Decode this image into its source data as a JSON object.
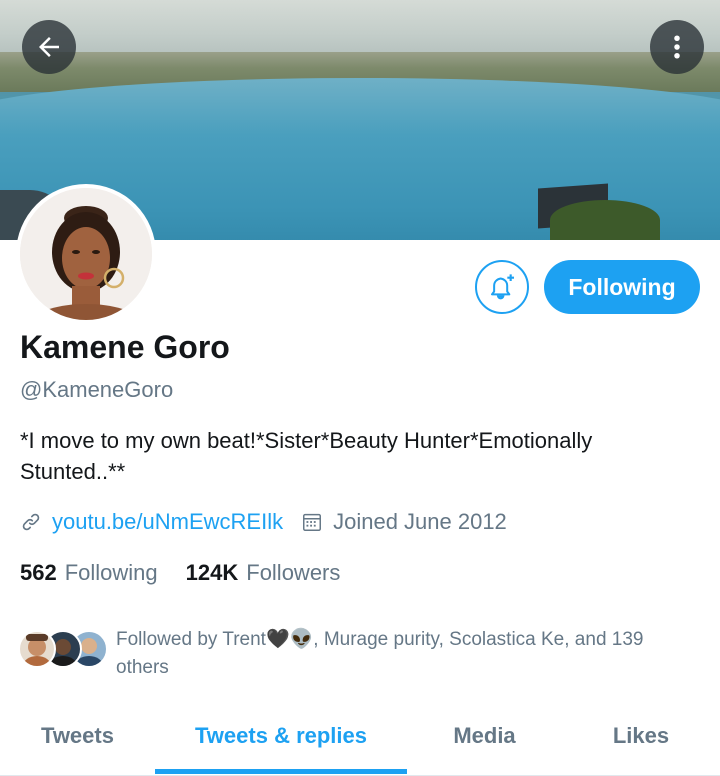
{
  "header": {
    "back_icon": "arrow-left-icon",
    "more_icon": "more-vertical-icon"
  },
  "profile": {
    "name": "Kamene Goro",
    "handle": "@KameneGoro",
    "bio": "*I move to my own beat!*Sister*Beauty Hunter*Emotionally Stunted..**",
    "link": "youtu.be/uNmEwcREIlk",
    "joined": "Joined June 2012",
    "following_count": "562",
    "following_label": "Following",
    "followers_count": "124K",
    "followers_label": "Followers",
    "followed_by": "Followed by Trent🖤👽, Murage purity, Scolastica Ke, and 139 others"
  },
  "actions": {
    "notify_icon": "bell-plus-icon",
    "follow_button": "Following"
  },
  "tabs": [
    {
      "label": "Tweets",
      "active": false
    },
    {
      "label": "Tweets & replies",
      "active": true
    },
    {
      "label": "Media",
      "active": false
    },
    {
      "label": "Likes",
      "active": false
    }
  ],
  "colors": {
    "accent": "#1da1f2",
    "secondary_text": "#657786",
    "primary_text": "#14171a"
  }
}
